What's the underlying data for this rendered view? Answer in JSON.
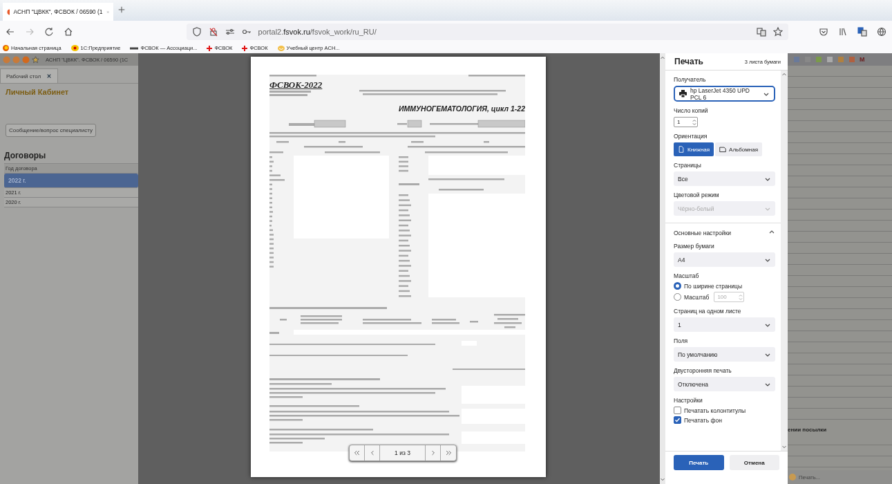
{
  "browser": {
    "tab": {
      "title": "АСНП \"ЦВКК\", ФСВОК / 06590 (1"
    },
    "url": "portal2.**fsvok.ru**/fsvok_work/ru_RU/",
    "bookmarks": [
      {
        "kind": "browser",
        "label": "Начальная страница"
      },
      {
        "kind": "onec",
        "label": "1С:Предприятие"
      },
      {
        "kind": "dash",
        "label": "ФСВОК — Ассоциаци..."
      },
      {
        "kind": "cross",
        "label": "ФСВОК"
      },
      {
        "kind": "cross",
        "label": "ФСВОК"
      },
      {
        "kind": "smile",
        "label": "Учебный центр АСН..."
      }
    ]
  },
  "app": {
    "title": "АСНП \"ЦВКК\". ФСВОК / 06590  (1С",
    "tab": "Рабочий стол",
    "heading": "Личный Кабинет",
    "message_button": "Сообщение/вопрос специалисту",
    "contracts": {
      "title": "Договоры",
      "column": "Год договора",
      "rows": [
        {
          "year": "2022 г.",
          "selected": true
        },
        {
          "year": "2021 г.",
          "selected": false
        },
        {
          "year": "2020 г.",
          "selected": false
        }
      ]
    },
    "toolbar_letter": "M",
    "right_text": "ении посылки",
    "status_item": "Печать..."
  },
  "preview": {
    "document": {
      "logo": "ФСВОК-2022",
      "title": "ИММУНОГЕМАТОЛОГИЯ, цикл 1-22"
    },
    "pager": "1 из 3"
  },
  "print_dialog": {
    "title": "Печать",
    "sheets": "3 листа бумаги",
    "destination": {
      "label": "Получатель",
      "value": "hp LaserJet 4350 UPD PCL 6"
    },
    "copies": {
      "label": "Число копий",
      "value": "1"
    },
    "orientation": {
      "label": "Ориентация",
      "options": [
        {
          "label": "Книжная",
          "selected": true
        },
        {
          "label": "Альбомная",
          "selected": false
        }
      ]
    },
    "pages": {
      "label": "Страницы",
      "value": "Все",
      "disabled": false
    },
    "color_mode": {
      "label": "Цветовой режим",
      "value": "Чёрно-белый",
      "disabled": true
    },
    "basic_settings": {
      "label": "Основные настройки",
      "expanded": true
    },
    "paper_size": {
      "label": "Размер бумаги",
      "value": "A4",
      "disabled": false
    },
    "scale": {
      "label": "Масштаб",
      "options": [
        {
          "label": "По ширине страницы",
          "selected": true
        },
        {
          "label": "Масштаб",
          "selected": false,
          "value": "100"
        }
      ]
    },
    "pages_per_sheet": {
      "label": "Страниц на одном листе",
      "value": "1",
      "disabled": false
    },
    "margins": {
      "label": "Поля",
      "value": "По умолчанию",
      "disabled": false
    },
    "duplex": {
      "label": "Двусторонняя печать",
      "value": "Отключена",
      "disabled": false
    },
    "options": {
      "label": "Настройки",
      "items": [
        {
          "label": "Печатать колонтитулы",
          "checked": false
        },
        {
          "label": "Печатать фон",
          "checked": true
        }
      ]
    },
    "buttons": [
      {
        "label": "Печать",
        "kind": "primary"
      },
      {
        "label": "Отмена",
        "kind": "secondary"
      }
    ]
  }
}
